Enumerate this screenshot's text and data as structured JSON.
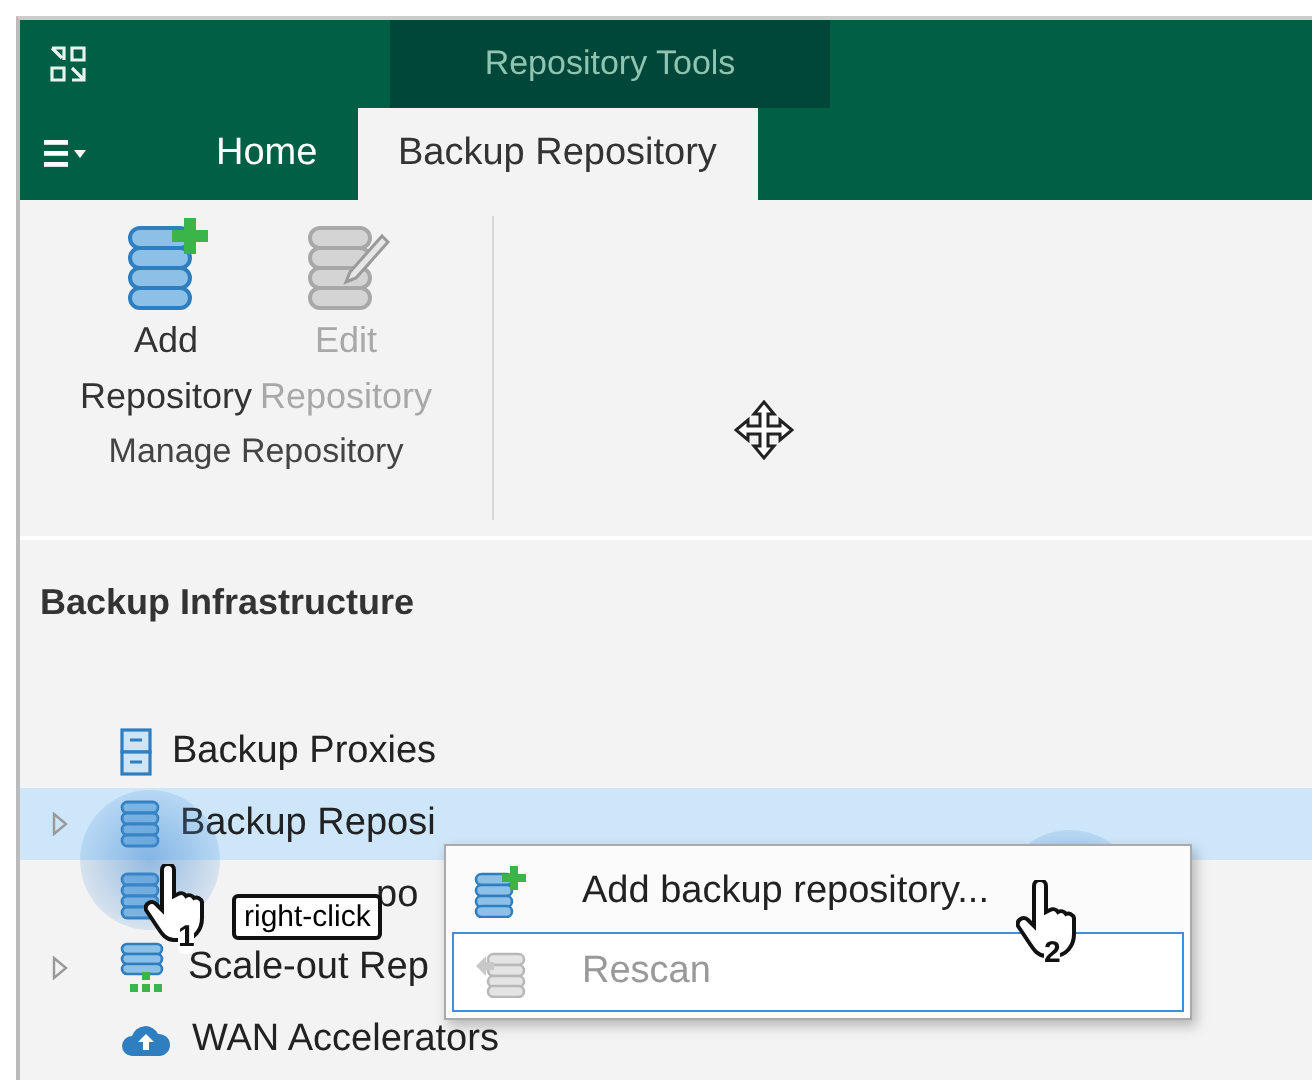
{
  "contextual_tab_group": "Repository Tools",
  "tabs": [
    {
      "label": "Home",
      "selected": false
    },
    {
      "label": "Backup Repository",
      "selected": true
    }
  ],
  "ribbon": {
    "buttons": [
      {
        "lines": [
          "Add",
          "Repository"
        ],
        "kind": "add",
        "disabled": false
      },
      {
        "lines": [
          "Edit",
          "Repository"
        ],
        "kind": "edit",
        "disabled": true
      }
    ],
    "group_label": "Manage Repository"
  },
  "section_title": "Backup Infrastructure",
  "tree": [
    {
      "label": "Backup Proxies",
      "kind": "proxy",
      "expandable": false,
      "selected": false
    },
    {
      "label": "Backup Reposi",
      "kind": "repository",
      "expandable": true,
      "selected": true
    },
    {
      "label": "po",
      "kind": "external",
      "expandable": false,
      "selected": false
    },
    {
      "label": "Scale-out Rep",
      "kind": "scaleout",
      "expandable": true,
      "selected": false
    },
    {
      "label": "WAN Accelerators",
      "kind": "wan",
      "expandable": false,
      "selected": false
    }
  ],
  "context_menu": [
    {
      "label": "Add backup repository...",
      "kind": "add",
      "disabled": false,
      "highlighted": false
    },
    {
      "label": "Rescan",
      "kind": "rescan",
      "disabled": true,
      "highlighted": true
    }
  ],
  "callouts": [
    {
      "step": "1",
      "label": "right-click"
    },
    {
      "step": "2"
    }
  ]
}
